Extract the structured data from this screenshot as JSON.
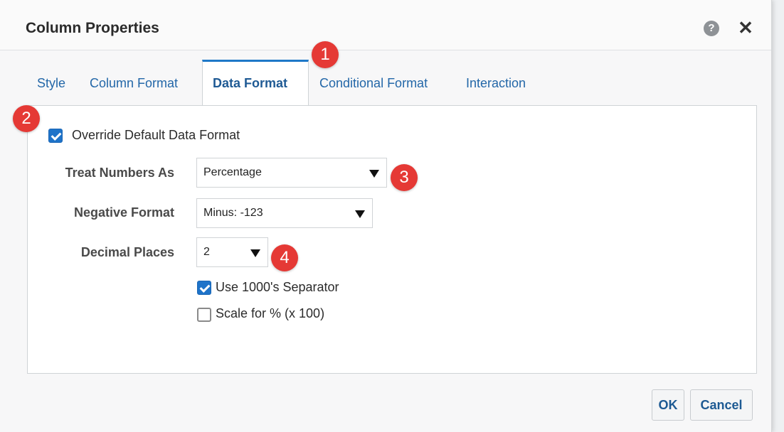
{
  "dialog": {
    "title": "Column Properties",
    "help_icon": "question-mark-icon",
    "close_icon": "close-icon",
    "close_glyph": "✕",
    "help_glyph": "?"
  },
  "tabs": [
    {
      "label": "Style",
      "active": false
    },
    {
      "label": "Column Format",
      "active": false
    },
    {
      "label": "Data Format",
      "active": true
    },
    {
      "label": "Conditional Format",
      "active": false
    },
    {
      "label": "Interaction",
      "active": false
    }
  ],
  "data_format": {
    "override_checkbox": {
      "label": "Override Default Data Format",
      "checked": true
    },
    "treat_numbers_as": {
      "label": "Treat Numbers As",
      "value": "Percentage"
    },
    "negative_format": {
      "label": "Negative Format",
      "value": "Minus: -123"
    },
    "decimal_places": {
      "label": "Decimal Places",
      "value": "2"
    },
    "use_separator": {
      "label": "Use 1000's Separator",
      "checked": true
    },
    "scale_percent": {
      "label": "Scale for % (x 100)",
      "checked": false
    }
  },
  "callouts": [
    "1",
    "2",
    "3",
    "4"
  ],
  "buttons": {
    "ok": "OK",
    "cancel": "Cancel"
  },
  "colors": {
    "accent": "#1e78c8",
    "link": "#2367a8",
    "callout": "#e53935"
  }
}
